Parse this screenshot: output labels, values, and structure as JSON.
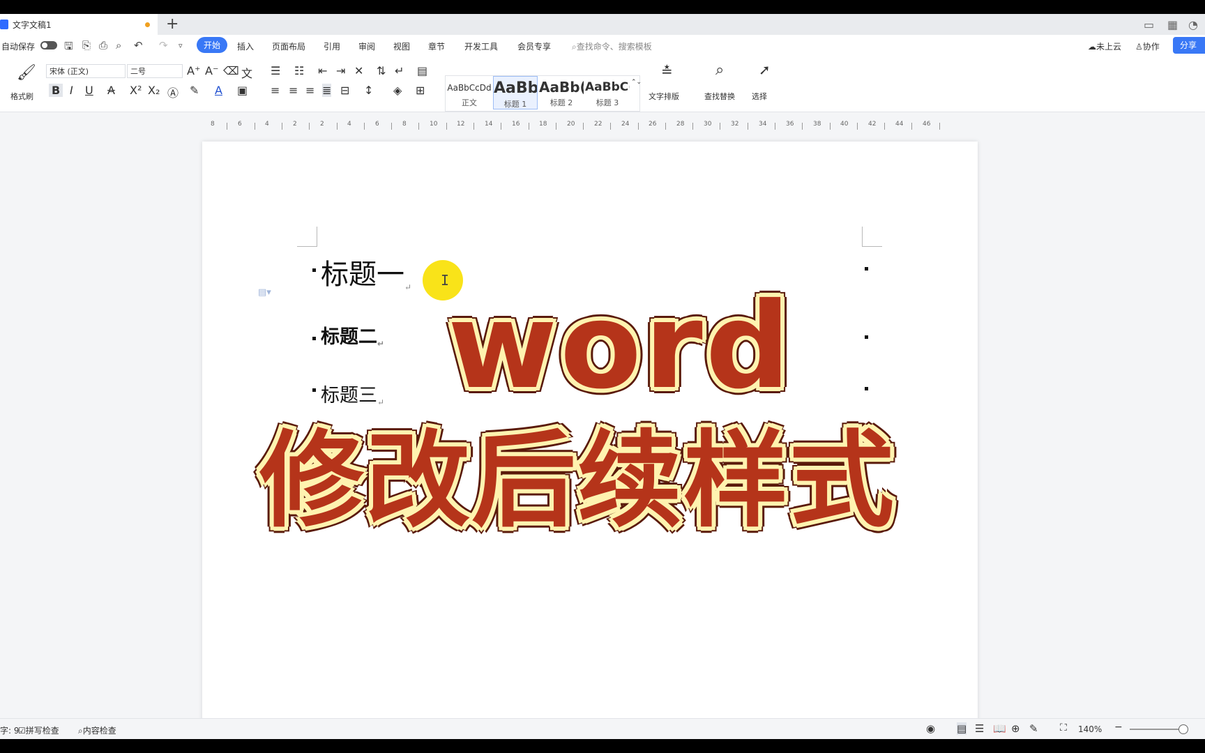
{
  "titlebar": {
    "doc_name": "文字文稿1",
    "add_tab": "+"
  },
  "menubar": {
    "autosave": "自动保存",
    "items": [
      "开始",
      "插入",
      "页面布局",
      "引用",
      "审阅",
      "视图",
      "章节",
      "开发工具",
      "会员专享"
    ],
    "search_placeholder": "查找命令、搜索模板",
    "cloud": "未上云",
    "collab": "协作",
    "share": "分享"
  },
  "ribbon": {
    "format_painter": "格式刷",
    "font_name": "宋体 (正文)",
    "font_size": "二号",
    "styles": [
      {
        "preview": "AaBbCcDd",
        "name": "正文"
      },
      {
        "preview": "AaBb",
        "name": "标题 1"
      },
      {
        "preview": "AaBb(",
        "name": "标题 2"
      },
      {
        "preview": "AaBbC(",
        "name": "标题 3"
      }
    ],
    "text_layout": "文字排版",
    "find_replace": "查找替换",
    "select": "选择"
  },
  "ruler": {
    "labels": [
      "8",
      "6",
      "4",
      "2",
      "2",
      "4",
      "6",
      "8",
      "10",
      "12",
      "14",
      "16",
      "18",
      "20",
      "22",
      "24",
      "26",
      "28",
      "30",
      "32",
      "34",
      "36",
      "38",
      "40",
      "42",
      "44",
      "46"
    ]
  },
  "document": {
    "heading1": "标题一",
    "heading2": "标题二",
    "heading3": "标题三",
    "para_mark": "↵"
  },
  "overlay": {
    "line1": "word",
    "line2": "修改后续样式",
    "colors": {
      "fill": "#b5341a",
      "outline": "#fff3b0",
      "edge": "#5a1a0a"
    }
  },
  "statusbar": {
    "page_info": "字: 9",
    "spell_check": "拼写检查",
    "content_check": "内容检查",
    "zoom": "140%"
  }
}
